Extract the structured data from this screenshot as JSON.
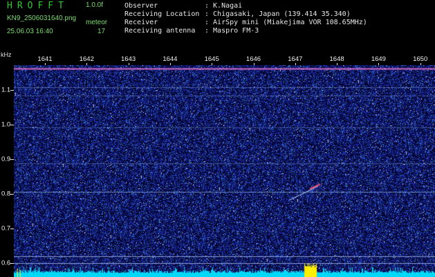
{
  "header": {
    "app_title": "HROFFT",
    "version": "1.0.0f",
    "filename": "KN9_2506031640.png",
    "mode": "meteor",
    "datetime": "25.06.03 16:40",
    "count": "17"
  },
  "info": {
    "observer_label": "Observer",
    "observer_value": ": K.Nagai",
    "location_label": "Receiving Location",
    "location_value": ": Chigasaki, Japan (139.414 35.340)",
    "receiver_label": "Receiver",
    "receiver_value": ": AirSpy mini (Miakejima VOR 108.65MHz)",
    "antenna_label": "Receiving antenna",
    "antenna_value": ": Maspro FM-3"
  },
  "axes": {
    "y_unit": "kHz",
    "y_ticks": [
      "1.1",
      "1.0",
      "0.9",
      "0.8",
      "0.7",
      "0.6"
    ],
    "x_ticks": [
      "1641",
      "1642",
      "1643",
      "1644",
      "1645",
      "1646",
      "1647",
      "1648",
      "1649",
      "1650"
    ]
  },
  "colors": {
    "background": "#03052e",
    "noise_base": "#1a2aa8",
    "histogram": "#00d8f8",
    "peak": "#ffee00",
    "title_green": "#32c832"
  }
}
